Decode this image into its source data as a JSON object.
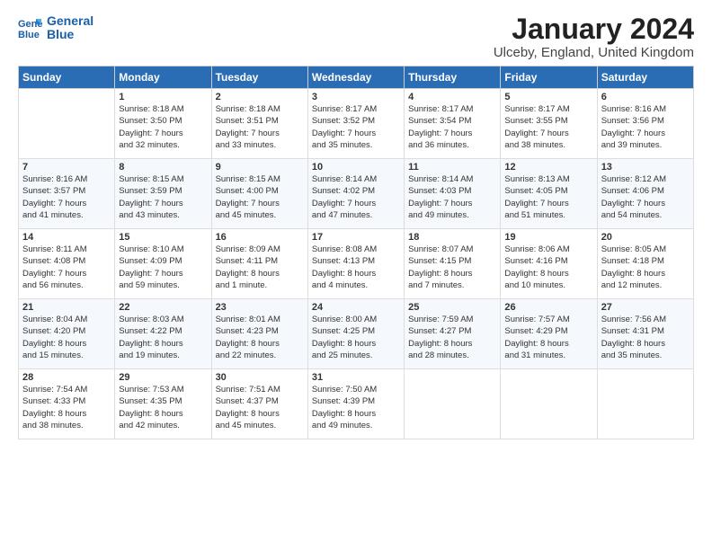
{
  "logo": {
    "line1": "General",
    "line2": "Blue"
  },
  "title": "January 2024",
  "location": "Ulceby, England, United Kingdom",
  "days_of_week": [
    "Sunday",
    "Monday",
    "Tuesday",
    "Wednesday",
    "Thursday",
    "Friday",
    "Saturday"
  ],
  "weeks": [
    [
      {
        "day": "",
        "content": ""
      },
      {
        "day": "1",
        "content": "Sunrise: 8:18 AM\nSunset: 3:50 PM\nDaylight: 7 hours\nand 32 minutes."
      },
      {
        "day": "2",
        "content": "Sunrise: 8:18 AM\nSunset: 3:51 PM\nDaylight: 7 hours\nand 33 minutes."
      },
      {
        "day": "3",
        "content": "Sunrise: 8:17 AM\nSunset: 3:52 PM\nDaylight: 7 hours\nand 35 minutes."
      },
      {
        "day": "4",
        "content": "Sunrise: 8:17 AM\nSunset: 3:54 PM\nDaylight: 7 hours\nand 36 minutes."
      },
      {
        "day": "5",
        "content": "Sunrise: 8:17 AM\nSunset: 3:55 PM\nDaylight: 7 hours\nand 38 minutes."
      },
      {
        "day": "6",
        "content": "Sunrise: 8:16 AM\nSunset: 3:56 PM\nDaylight: 7 hours\nand 39 minutes."
      }
    ],
    [
      {
        "day": "7",
        "content": "Sunrise: 8:16 AM\nSunset: 3:57 PM\nDaylight: 7 hours\nand 41 minutes."
      },
      {
        "day": "8",
        "content": "Sunrise: 8:15 AM\nSunset: 3:59 PM\nDaylight: 7 hours\nand 43 minutes."
      },
      {
        "day": "9",
        "content": "Sunrise: 8:15 AM\nSunset: 4:00 PM\nDaylight: 7 hours\nand 45 minutes."
      },
      {
        "day": "10",
        "content": "Sunrise: 8:14 AM\nSunset: 4:02 PM\nDaylight: 7 hours\nand 47 minutes."
      },
      {
        "day": "11",
        "content": "Sunrise: 8:14 AM\nSunset: 4:03 PM\nDaylight: 7 hours\nand 49 minutes."
      },
      {
        "day": "12",
        "content": "Sunrise: 8:13 AM\nSunset: 4:05 PM\nDaylight: 7 hours\nand 51 minutes."
      },
      {
        "day": "13",
        "content": "Sunrise: 8:12 AM\nSunset: 4:06 PM\nDaylight: 7 hours\nand 54 minutes."
      }
    ],
    [
      {
        "day": "14",
        "content": "Sunrise: 8:11 AM\nSunset: 4:08 PM\nDaylight: 7 hours\nand 56 minutes."
      },
      {
        "day": "15",
        "content": "Sunrise: 8:10 AM\nSunset: 4:09 PM\nDaylight: 7 hours\nand 59 minutes."
      },
      {
        "day": "16",
        "content": "Sunrise: 8:09 AM\nSunset: 4:11 PM\nDaylight: 8 hours\nand 1 minute."
      },
      {
        "day": "17",
        "content": "Sunrise: 8:08 AM\nSunset: 4:13 PM\nDaylight: 8 hours\nand 4 minutes."
      },
      {
        "day": "18",
        "content": "Sunrise: 8:07 AM\nSunset: 4:15 PM\nDaylight: 8 hours\nand 7 minutes."
      },
      {
        "day": "19",
        "content": "Sunrise: 8:06 AM\nSunset: 4:16 PM\nDaylight: 8 hours\nand 10 minutes."
      },
      {
        "day": "20",
        "content": "Sunrise: 8:05 AM\nSunset: 4:18 PM\nDaylight: 8 hours\nand 12 minutes."
      }
    ],
    [
      {
        "day": "21",
        "content": "Sunrise: 8:04 AM\nSunset: 4:20 PM\nDaylight: 8 hours\nand 15 minutes."
      },
      {
        "day": "22",
        "content": "Sunrise: 8:03 AM\nSunset: 4:22 PM\nDaylight: 8 hours\nand 19 minutes."
      },
      {
        "day": "23",
        "content": "Sunrise: 8:01 AM\nSunset: 4:23 PM\nDaylight: 8 hours\nand 22 minutes."
      },
      {
        "day": "24",
        "content": "Sunrise: 8:00 AM\nSunset: 4:25 PM\nDaylight: 8 hours\nand 25 minutes."
      },
      {
        "day": "25",
        "content": "Sunrise: 7:59 AM\nSunset: 4:27 PM\nDaylight: 8 hours\nand 28 minutes."
      },
      {
        "day": "26",
        "content": "Sunrise: 7:57 AM\nSunset: 4:29 PM\nDaylight: 8 hours\nand 31 minutes."
      },
      {
        "day": "27",
        "content": "Sunrise: 7:56 AM\nSunset: 4:31 PM\nDaylight: 8 hours\nand 35 minutes."
      }
    ],
    [
      {
        "day": "28",
        "content": "Sunrise: 7:54 AM\nSunset: 4:33 PM\nDaylight: 8 hours\nand 38 minutes."
      },
      {
        "day": "29",
        "content": "Sunrise: 7:53 AM\nSunset: 4:35 PM\nDaylight: 8 hours\nand 42 minutes."
      },
      {
        "day": "30",
        "content": "Sunrise: 7:51 AM\nSunset: 4:37 PM\nDaylight: 8 hours\nand 45 minutes."
      },
      {
        "day": "31",
        "content": "Sunrise: 7:50 AM\nSunset: 4:39 PM\nDaylight: 8 hours\nand 49 minutes."
      },
      {
        "day": "",
        "content": ""
      },
      {
        "day": "",
        "content": ""
      },
      {
        "day": "",
        "content": ""
      }
    ]
  ]
}
